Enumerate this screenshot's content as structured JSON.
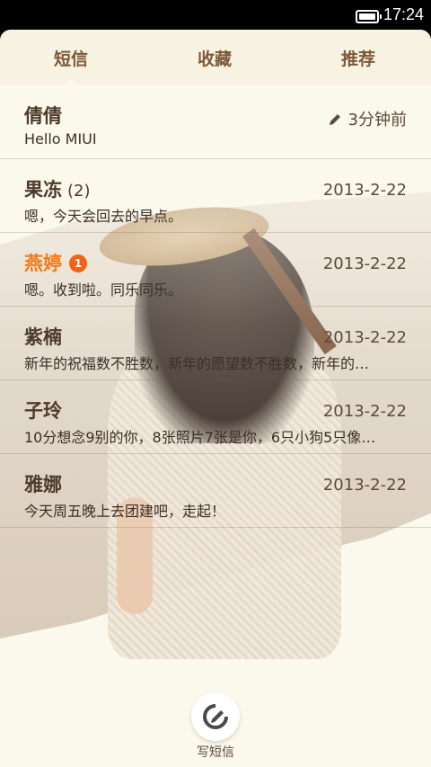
{
  "statusbar": {
    "time": "17:24",
    "battery_icon": "battery-icon"
  },
  "tabs": [
    {
      "label": "短信"
    },
    {
      "label": "收藏"
    },
    {
      "label": "推荐"
    }
  ],
  "conversations": [
    {
      "name": "倩倩",
      "count": "",
      "badge": "",
      "time": "3分钟前",
      "preview": "Hello MIUI",
      "highlight": false,
      "draft_icon": "pencil-icon"
    },
    {
      "name": "果冻",
      "count": "(2)",
      "badge": "",
      "time": "2013-2-22",
      "preview": "嗯，今天会回去的早点。",
      "highlight": false
    },
    {
      "name": "燕婷",
      "count": "",
      "badge": "1",
      "time": "2013-2-22",
      "preview": "嗯。收到啦。同乐同乐。",
      "highlight": true
    },
    {
      "name": "紫楠",
      "count": "",
      "badge": "",
      "time": "2013-2-22",
      "preview": "新年的祝福数不胜数，新年的愿望数不胜数，新年的…",
      "highlight": false
    },
    {
      "name": "子玲",
      "count": "",
      "badge": "",
      "time": "2013-2-22",
      "preview": "10分想念9别的你，8张照片7张是你，6只小狗5只像…",
      "highlight": false
    },
    {
      "name": "雅娜",
      "count": "",
      "badge": "",
      "time": "2013-2-22",
      "preview": "今天周五晚上去团建吧，走起！",
      "highlight": false
    }
  ],
  "compose": {
    "label": "写短信",
    "icon": "compose-icon"
  },
  "colors": {
    "accent": "#f07a1a",
    "badge": "#f06318",
    "tab_text": "#7b5a3a",
    "background": "#fbf8ec"
  }
}
